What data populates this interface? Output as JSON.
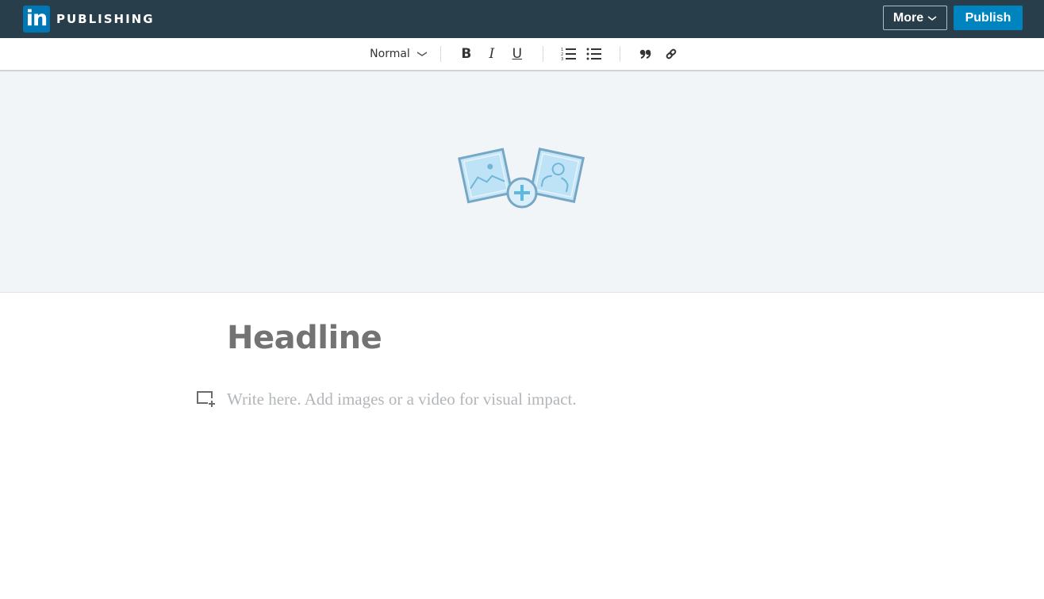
{
  "header": {
    "logo_text": "in",
    "brand": "PUBLISHING",
    "more_label": "More",
    "publish_label": "Publish",
    "colors": {
      "bar": "#283e4a",
      "logo": "#0077b5",
      "publish": "#0084bf"
    }
  },
  "toolbar": {
    "style_select": "Normal",
    "buttons": [
      {
        "name": "bold",
        "glyph": "B"
      },
      {
        "name": "italic",
        "glyph": "I"
      },
      {
        "name": "underline",
        "glyph": "U"
      },
      {
        "name": "numbered-list",
        "icon": "numbered-list-icon"
      },
      {
        "name": "bulleted-list",
        "icon": "bulleted-list-icon"
      },
      {
        "name": "quote",
        "icon": "quote-icon"
      },
      {
        "name": "link",
        "icon": "link-icon"
      }
    ]
  },
  "cover": {
    "icon": "add-cover-image-icon"
  },
  "editor": {
    "headline_placeholder": "Headline",
    "body_placeholder": "Write here. Add images or a video for visual impact.",
    "add_media_icon": "add-media-icon"
  }
}
